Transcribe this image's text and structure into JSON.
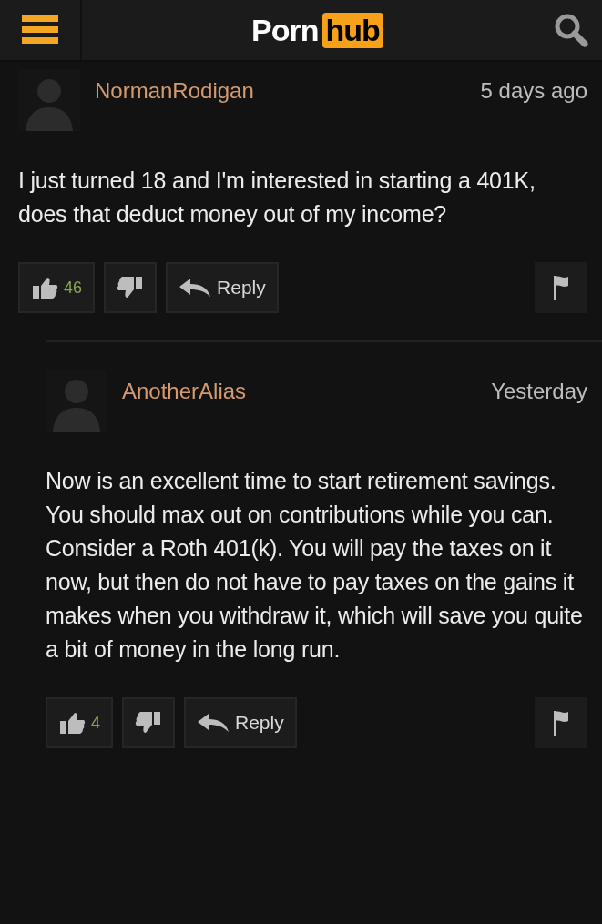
{
  "header": {
    "logo_left": "Porn",
    "logo_right": "hub"
  },
  "comments": [
    {
      "author": "NormanRodigan",
      "time": "5 days ago",
      "text": "I just turned 18 and I'm interested in starting a 401K, does that deduct money out of my income?",
      "likes": "46",
      "reply_label": "Reply",
      "reply": false
    },
    {
      "author": "AnotherAlias",
      "time": "Yesterday",
      "text": "Now is an excellent time to start retirement savings. You should max out on contributions while you can. Consider a Roth 401(k). You will pay the taxes on it now, but then do not have to pay taxes on the gains it makes when you withdraw it, which will save you quite a bit of money in the long run.",
      "likes": "4",
      "reply_label": "Reply",
      "reply": true
    }
  ]
}
